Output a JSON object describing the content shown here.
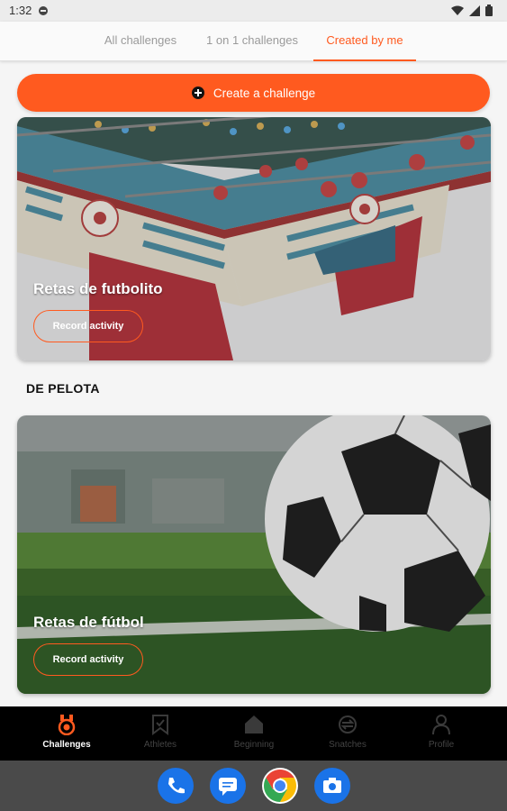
{
  "status_bar": {
    "time": "1:32"
  },
  "tabs": [
    {
      "label": "All challenges",
      "active": false
    },
    {
      "label": "1 on 1 challenges",
      "active": false
    },
    {
      "label": "Created by me",
      "active": true
    }
  ],
  "create_button": {
    "label": "Create a challenge",
    "icon": "plus-circle-icon"
  },
  "cards": [
    {
      "title": "Retas de futbolito",
      "button": "Record activity",
      "image": "foosball-table"
    },
    {
      "title": "Retas de fútbol",
      "button": "Record activity",
      "image": "soccer-ball-on-grass"
    }
  ],
  "section_title": "DE PELOTA",
  "bottom_nav": [
    {
      "label": "Challenges",
      "icon": "medal-icon",
      "active": true
    },
    {
      "label": "Athletes",
      "icon": "bookmark-icon",
      "active": false
    },
    {
      "label": "Beginning",
      "icon": "home-icon",
      "active": false
    },
    {
      "label": "Snatches",
      "icon": "sync-icon",
      "active": false
    },
    {
      "label": "Profile",
      "icon": "person-icon",
      "active": false
    }
  ],
  "dock_apps": [
    "phone-icon",
    "messages-icon",
    "chrome-icon",
    "camera-icon"
  ],
  "colors": {
    "accent": "#ff5a1f",
    "nav_bg": "#000000",
    "system_bar": "#4a4a4a"
  }
}
